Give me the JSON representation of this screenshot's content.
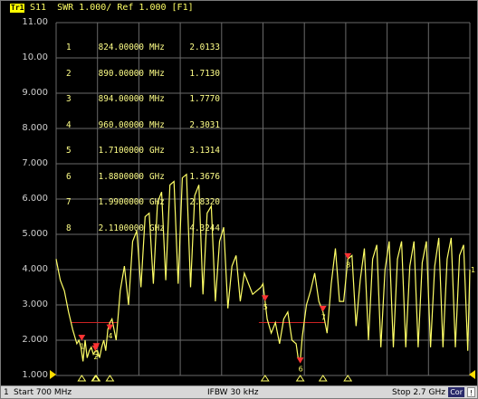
{
  "header": {
    "trace_tag": "Tr1",
    "param": "S11  SWR 1.000/ Ref 1.000 [F1]"
  },
  "y_axis": {
    "labels": [
      "11.00",
      "10.00",
      "9.000",
      "8.000",
      "7.000",
      "6.000",
      "5.000",
      "4.000",
      "3.000",
      "2.000",
      "1.000"
    ]
  },
  "markers": [
    {
      "num": "1",
      "freq": "824.00000",
      "unit": "MHz",
      "value": "2.0133"
    },
    {
      "num": "2",
      "freq": "890.00000",
      "unit": "MHz",
      "value": "1.7130"
    },
    {
      "num": "3",
      "freq": "894.00000",
      "unit": "MHz",
      "value": "1.7770"
    },
    {
      "num": "4",
      "freq": "960.00000",
      "unit": "MHz",
      "value": "2.3031"
    },
    {
      "num": "5",
      "freq": "1.7100000",
      "unit": "GHz",
      "value": "3.1314"
    },
    {
      "num": "6",
      "freq": "1.8800000",
      "unit": "GHz",
      "value": "1.3676"
    },
    {
      "num": "7",
      "freq": "1.9900000",
      "unit": "GHz",
      "value": "2.8320"
    },
    {
      "num": "8",
      "freq": "2.1100000",
      "unit": "GHz",
      "value": "4.3244"
    }
  ],
  "footer": {
    "start": "Start 700 MHz",
    "ifbw": "IFBW 30 kHz",
    "stop": "Stop 2.7 GHz",
    "cor": "Cor",
    "warn": "!",
    "channel": "1"
  },
  "colors": {
    "trace": "#ffff66",
    "grid": "#6a6a6a",
    "marker": "#ff3333",
    "limit": "#cc2222",
    "background": "#000000"
  },
  "chart_data": {
    "type": "line",
    "x_unit": "GHz",
    "xlim": [
      0.7,
      2.7
    ],
    "ylim": [
      1.0,
      11.0
    ],
    "y_scale": "linear",
    "grid": true,
    "series": [
      {
        "x": [
          0.7,
          0.72,
          0.74,
          0.76,
          0.78,
          0.8,
          0.81,
          0.82,
          0.83,
          0.84,
          0.85,
          0.86,
          0.87,
          0.88,
          0.89,
          0.9,
          0.91,
          0.92,
          0.93,
          0.94,
          0.95,
          0.96,
          0.97,
          0.99,
          1.01,
          1.03,
          1.05,
          1.07,
          1.09,
          1.11,
          1.13,
          1.15,
          1.17,
          1.19,
          1.21,
          1.23,
          1.25,
          1.27,
          1.29,
          1.31,
          1.33,
          1.35,
          1.37,
          1.39,
          1.41,
          1.43,
          1.45,
          1.47,
          1.49,
          1.51,
          1.53,
          1.55,
          1.57,
          1.59,
          1.61,
          1.63,
          1.65,
          1.67,
          1.69,
          1.7,
          1.71,
          1.72,
          1.74,
          1.76,
          1.78,
          1.8,
          1.82,
          1.84,
          1.86,
          1.87,
          1.88,
          1.89,
          1.91,
          1.93,
          1.95,
          1.97,
          1.99,
          2.01,
          2.03,
          2.05,
          2.07,
          2.09,
          2.11,
          2.13,
          2.15,
          2.17,
          2.19,
          2.21,
          2.23,
          2.25,
          2.27,
          2.29,
          2.31,
          2.33,
          2.35,
          2.37,
          2.39,
          2.41,
          2.43,
          2.45,
          2.47,
          2.49,
          2.51,
          2.53,
          2.55,
          2.57,
          2.59,
          2.61,
          2.63,
          2.65,
          2.67,
          2.69,
          2.7
        ],
        "y": [
          4.3,
          3.7,
          3.4,
          2.8,
          2.3,
          1.9,
          2.0,
          1.8,
          1.4,
          2.0,
          1.5,
          1.7,
          1.8,
          1.6,
          1.7,
          1.7,
          1.5,
          1.8,
          2.0,
          1.7,
          2.3,
          2.5,
          2.6,
          2.0,
          3.4,
          4.1,
          3.0,
          4.8,
          5.1,
          3.5,
          5.5,
          5.6,
          3.6,
          5.9,
          6.2,
          3.7,
          6.4,
          6.5,
          3.6,
          6.6,
          6.7,
          3.5,
          6.1,
          6.4,
          3.3,
          5.6,
          5.8,
          3.1,
          4.8,
          5.2,
          2.9,
          4.1,
          4.4,
          3.1,
          3.9,
          3.6,
          3.3,
          3.4,
          3.5,
          3.6,
          3.1,
          2.6,
          2.2,
          2.5,
          1.9,
          2.6,
          2.8,
          2.0,
          1.9,
          1.5,
          1.4,
          2.1,
          3.0,
          3.4,
          3.9,
          3.1,
          2.8,
          2.2,
          3.6,
          4.6,
          3.1,
          3.1,
          4.3,
          4.4,
          2.4,
          3.7,
          4.6,
          2.0,
          4.3,
          4.7,
          1.8,
          4.0,
          4.8,
          1.8,
          4.3,
          4.8,
          1.8,
          4.1,
          4.8,
          1.8,
          4.2,
          4.8,
          1.8,
          4.1,
          4.9,
          1.8,
          4.3,
          4.9,
          1.8,
          4.4,
          4.7,
          1.7,
          4.0
        ]
      }
    ],
    "limit_lines": [
      {
        "x": [
          0.77,
          1.0
        ],
        "y": 2.5
      },
      {
        "x": [
          1.68,
          2.0
        ],
        "y": 2.5
      }
    ]
  }
}
